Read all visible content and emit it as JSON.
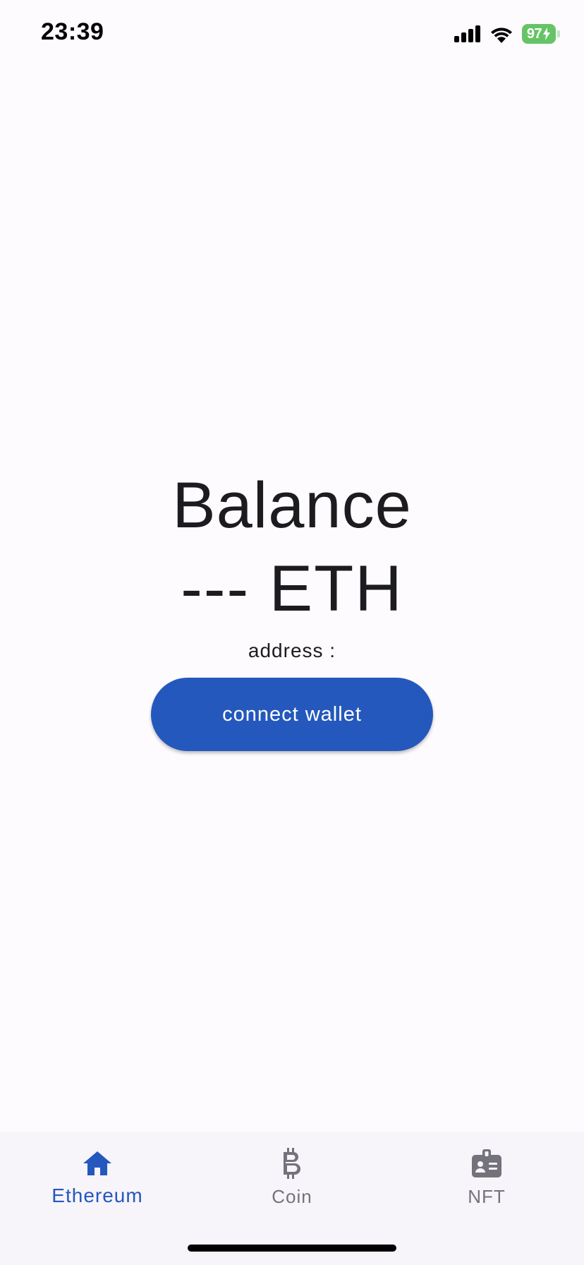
{
  "status_bar": {
    "time": "23:39",
    "battery_level": "97",
    "battery_charging": true,
    "icons": [
      "signal-icon",
      "wifi-icon",
      "battery-icon"
    ]
  },
  "main": {
    "balance_title": "Balance",
    "balance_value": "--- ETH",
    "address_label": "address :",
    "connect_button_label": "connect wallet"
  },
  "bottom_nav": {
    "items": [
      {
        "label": "Ethereum",
        "icon": "home-icon",
        "active": true
      },
      {
        "label": "Coin",
        "icon": "bitcoin-icon",
        "active": false
      },
      {
        "label": "NFT",
        "icon": "badge-icon",
        "active": false
      }
    ]
  },
  "colors": {
    "accent": "#2458BC",
    "background": "#FDFBFE",
    "nav_background": "#F7F4FA",
    "inactive": "#74727A",
    "battery": "#65C466"
  }
}
